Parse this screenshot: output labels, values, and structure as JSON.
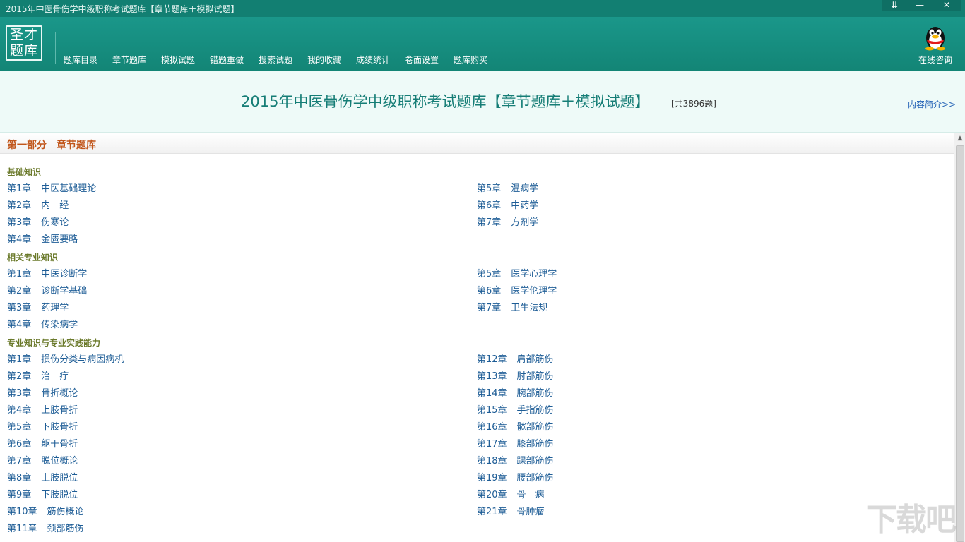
{
  "window": {
    "title": "2015年中医骨伤学中级职称考试题库【章节题库＋模拟试题】",
    "controls": [
      "⇊",
      "—",
      "✕"
    ]
  },
  "toolbar": {
    "logo": {
      "line1": "圣才",
      "line2": "题库"
    },
    "nav": [
      "题库目录",
      "章节题库",
      "模拟试题",
      "错题重做",
      "搜索试题",
      "我的收藏",
      "成绩统计",
      "卷面设置",
      "题库购买"
    ],
    "online_label": "在线咨询"
  },
  "banner": {
    "title": "2015年中医骨伤学中级职称考试题库【章节题库＋模拟试题】",
    "count": "[共3896题]",
    "intro_link": "内容简介>>"
  },
  "part": {
    "label": "第一部分　章节题库"
  },
  "sections": [
    {
      "name": "基础知识",
      "left": [
        [
          "第1章",
          "中医基础理论"
        ],
        [
          "第2章",
          "内　经"
        ],
        [
          "第3章",
          "伤寒论"
        ],
        [
          "第4章",
          "金匮要略"
        ]
      ],
      "right": [
        [
          "第5章",
          "温病学"
        ],
        [
          "第6章",
          "中药学"
        ],
        [
          "第7章",
          "方剂学"
        ]
      ]
    },
    {
      "name": "相关专业知识",
      "left": [
        [
          "第1章",
          "中医诊断学"
        ],
        [
          "第2章",
          "诊断学基础"
        ],
        [
          "第3章",
          "药理学"
        ],
        [
          "第4章",
          "传染病学"
        ]
      ],
      "right": [
        [
          "第5章",
          "医学心理学"
        ],
        [
          "第6章",
          "医学伦理学"
        ],
        [
          "第7章",
          "卫生法规"
        ]
      ]
    },
    {
      "name": "专业知识与专业实践能力",
      "left": [
        [
          "第1章",
          "损伤分类与病因病机"
        ],
        [
          "第2章",
          "治　疗"
        ],
        [
          "第3章",
          "骨折概论"
        ],
        [
          "第4章",
          "上肢骨折"
        ],
        [
          "第5章",
          "下肢骨折"
        ],
        [
          "第6章",
          "躯干骨折"
        ],
        [
          "第7章",
          "脱位概论"
        ],
        [
          "第8章",
          "上肢脱位"
        ],
        [
          "第9章",
          "下肢脱位"
        ],
        [
          "第10章",
          "筋伤概论"
        ],
        [
          "第11章",
          "颈部筋伤"
        ]
      ],
      "right": [
        [
          "第12章",
          "肩部筋伤"
        ],
        [
          "第13章",
          "肘部筋伤"
        ],
        [
          "第14章",
          "腕部筋伤"
        ],
        [
          "第15章",
          "手指筋伤"
        ],
        [
          "第16章",
          "髋部筋伤"
        ],
        [
          "第17章",
          "膝部筋伤"
        ],
        [
          "第18章",
          "踝部筋伤"
        ],
        [
          "第19章",
          "腰部筋伤"
        ],
        [
          "第20章",
          "骨　病"
        ],
        [
          "第21章",
          "骨肿瘤"
        ]
      ]
    }
  ],
  "watermark": "下载吧",
  "colors": {
    "titlebar": "#127f72",
    "toolbar": "#1a978a",
    "banner_bg": "#eefaf8",
    "part_label": "#c1561b",
    "section": "#6b7a2b",
    "chapter": "#1e5d96"
  }
}
